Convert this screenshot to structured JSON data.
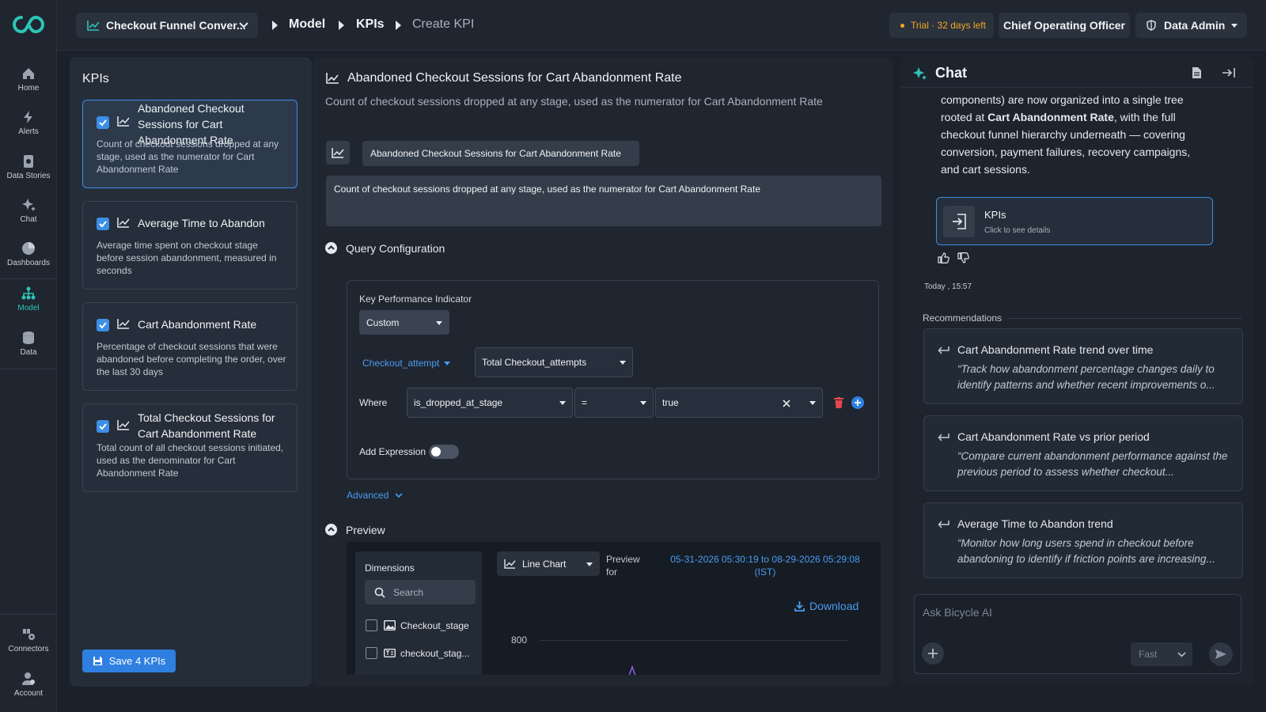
{
  "nav": {
    "items": [
      {
        "label": "Home",
        "icon": "home-icon"
      },
      {
        "label": "Alerts",
        "icon": "bolt-icon"
      },
      {
        "label": "Data Stories",
        "icon": "story-icon"
      },
      {
        "label": "Chat",
        "icon": "sparkle-icon"
      },
      {
        "label": "Dashboards",
        "icon": "pie-icon"
      },
      {
        "label": "Model",
        "icon": "model-icon"
      },
      {
        "label": "Data",
        "icon": "database-icon"
      }
    ],
    "bottom": [
      {
        "label": "Connectors",
        "icon": "connectors-icon"
      },
      {
        "label": "Account",
        "icon": "account-icon"
      }
    ]
  },
  "topbar": {
    "project": "Checkout Funnel Conver...",
    "breadcrumbs": [
      "Model",
      "KPIs",
      "Create KPI"
    ],
    "trial": "Trial · 32 days left",
    "role": "Chief Operating Officer",
    "user": "Data Admin"
  },
  "kpis": {
    "heading": "KPIs",
    "cards": [
      {
        "title": "Abandoned Checkout Sessions for Cart Abandonment Rate",
        "desc": "Count of checkout sessions dropped at any stage, used as the numerator for Cart Abandonment Rate"
      },
      {
        "title": "Average Time to Abandon",
        "desc": "Average time spent on checkout stage before session abandonment, measured in seconds"
      },
      {
        "title": "Cart Abandonment Rate",
        "desc": "Percentage of checkout sessions that were abandoned before completing the order, over the last 30 days"
      },
      {
        "title": "Total Checkout Sessions for Cart Abandonment Rate",
        "desc": "Total count of all checkout sessions initiated, used as the denominator for Cart Abandonment Rate"
      }
    ],
    "save": "Save 4 KPIs"
  },
  "editor": {
    "title": "Abandoned Checkout Sessions for Cart Abandonment Rate",
    "subtitle": "Count of checkout sessions dropped at any stage, used as the numerator for Cart Abandonment Rate",
    "name_value": "Abandoned Checkout Sessions for Cart Abandonment Rate",
    "desc_value": "Count of checkout sessions dropped at any stage, used as the numerator for Cart Abandonment Rate",
    "query_heading": "Query Configuration",
    "kpi_label": "Key Performance Indicator",
    "kpi_type": "Custom",
    "entity": "Checkout_attempt",
    "measure": "Total Checkout_attempts",
    "where_label": "Where",
    "where_field": "is_dropped_at_stage",
    "where_op": "=",
    "where_value": "true",
    "add_expression": "Add Expression",
    "advanced": "Advanced",
    "preview_heading": "Preview",
    "dimensions_label": "Dimensions",
    "search_placeholder": "Search",
    "dimensions": [
      "Checkout_stage",
      "checkout_stag..."
    ],
    "chart_type": "Line Chart",
    "preview_for": "Preview for",
    "date_range": "05-31-2026 05:30:19 to 08-29-2026 05:29:08 (IST)",
    "download": "Download",
    "y_tick": "800"
  },
  "chat": {
    "title": "Chat",
    "message_parts": [
      "components) are now organized into a single tree rooted at ",
      "Cart Abandonment Rate",
      ", with the full checkout funnel hierarchy underneath — covering conversion, payment failures, recovery campaigns, and cart sessions."
    ],
    "card_title": "KPIs",
    "card_sub": "Click to see details",
    "timestamp": "Today , 15:57",
    "recommendations_label": "Recommendations",
    "recommendations": [
      {
        "title": "Cart Abandonment Rate trend over time",
        "body": "“Track how abandonment percentage changes daily to identify patterns and whether recent improvements o..."
      },
      {
        "title": "Cart Abandonment Rate vs prior period",
        "body": "“Compare current abandonment performance against the previous period to assess whether checkout..."
      },
      {
        "title": "Average Time to Abandon trend",
        "body": "“Monitor how long users spend in checkout before abandoning to identify if friction points are increasing..."
      }
    ],
    "input_placeholder": "Ask Bicycle AI",
    "mode": "Fast"
  },
  "colors": {
    "accent": "#3d8fe6",
    "brand": "#2ec4b6",
    "trial": "#f5a623",
    "danger": "#e5484d"
  }
}
